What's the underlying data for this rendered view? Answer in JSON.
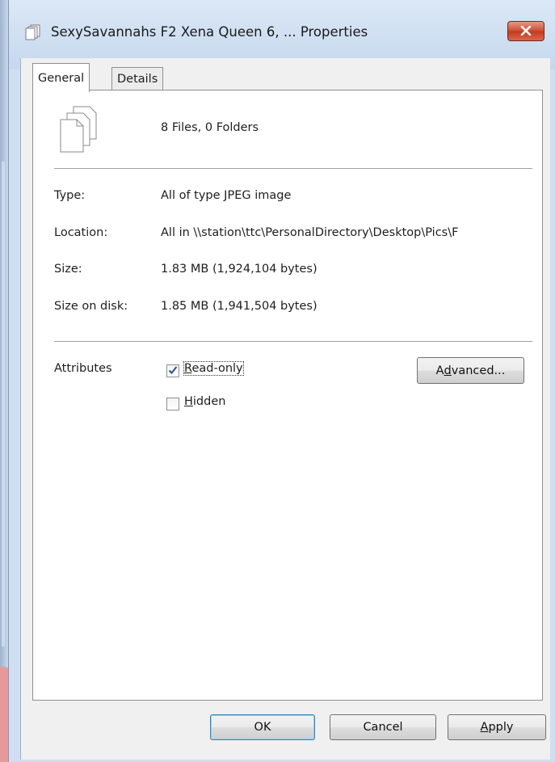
{
  "window": {
    "title": "SexySavannahs F2 Xena Queen 6, ... Properties",
    "close_color": "#c74528"
  },
  "tabs": [
    {
      "label": "General",
      "active": true
    },
    {
      "label": "Details",
      "active": false
    }
  ],
  "summary": "8 Files, 0 Folders",
  "properties": {
    "type_label": "Type:",
    "type_value": "All of type JPEG image",
    "location_label": "Location:",
    "location_value": "All in \\\\station\\ttc\\PersonalDirectory\\Desktop\\Pics\\F",
    "size_label": "Size:",
    "size_value": "1.83 MB (1,924,104 bytes)",
    "size_on_disk_label": "Size on disk:",
    "size_on_disk_value": "1.85 MB (1,941,504 bytes)"
  },
  "attributes": {
    "label": "Attributes",
    "read_only": {
      "pre": "",
      "key": "R",
      "rest": "ead-only",
      "checked": true
    },
    "hidden": {
      "pre": "",
      "key": "H",
      "rest": "idden",
      "checked": false
    },
    "advanced": {
      "pre": "A",
      "key": "d",
      "rest": "vanced..."
    }
  },
  "footer": {
    "ok": "OK",
    "cancel": "Cancel",
    "apply": {
      "pre": "",
      "key": "A",
      "rest": "pply"
    }
  }
}
